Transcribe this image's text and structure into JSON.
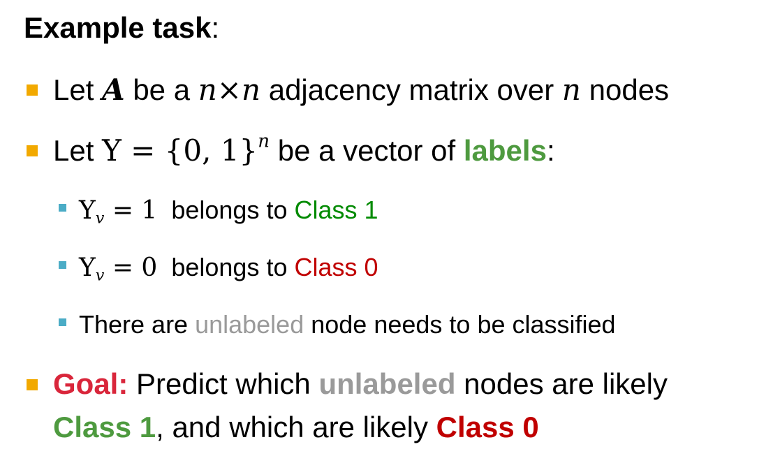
{
  "heading": {
    "bold": "Example task",
    "rest": ":"
  },
  "bullets": [
    {
      "pre": "Let ",
      "A": "A",
      "mid1": " be a ",
      "dim": "n×n",
      "mid2": " adjacency matrix over ",
      "n": "n",
      "post": " nodes"
    },
    {
      "pre": "Let ",
      "math": "Y = {0, 1}",
      "sup": "n",
      "mid": " be a vector of ",
      "labels": "labels",
      "post": ":"
    }
  ],
  "subbullets": [
    {
      "Y": "Y",
      "sub": "v",
      "eq": " = 1",
      "text": "  belongs to ",
      "cls": "Class 1"
    },
    {
      "Y": "Y",
      "sub": "v",
      "eq": " = 0",
      "text": "  belongs to ",
      "cls": "Class 0"
    },
    {
      "pre": "There are ",
      "unlabeled": "unlabeled",
      "post": " node needs to be classified"
    }
  ],
  "goal": {
    "label": "Goal:",
    "pre": " Predict which ",
    "unlabeled": "unlabeled",
    "post": " nodes are likely",
    "class1": "Class 1",
    "mid": ", and which are likely ",
    "class0": "Class 0"
  },
  "colors": {
    "bullet_primary": "#F2A900",
    "bullet_secondary": "#4BACC6",
    "labels_green": "#4E9A3F",
    "class1_green": "#008A00",
    "class0_red": "#C00000",
    "goal_crimson": "#D9263B",
    "unlabeled_gray": "#9A9A9A"
  }
}
